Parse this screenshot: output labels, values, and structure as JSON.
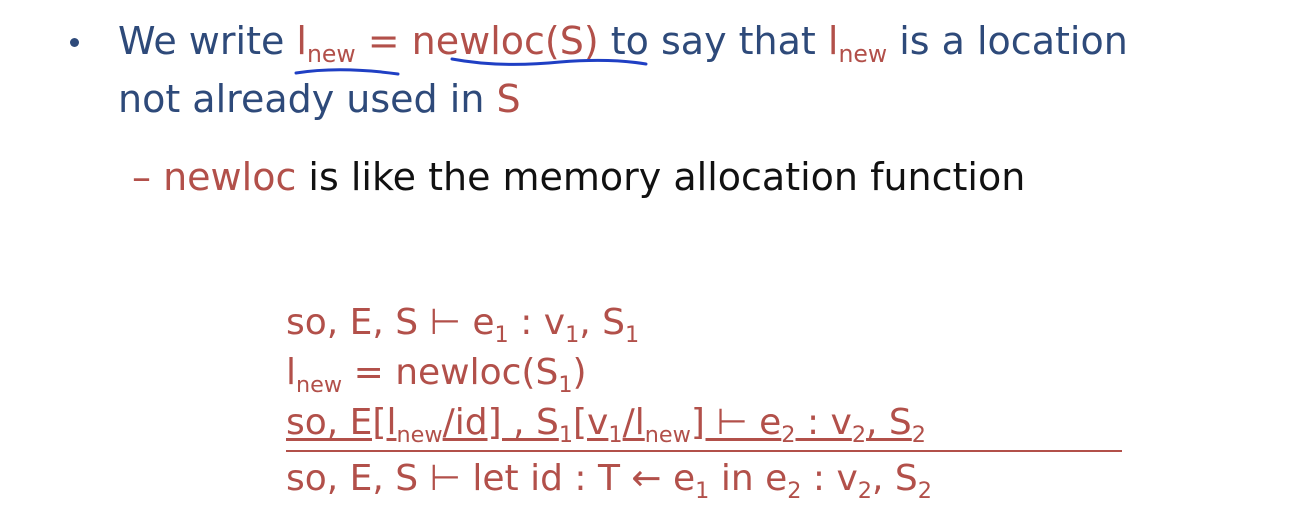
{
  "bullet": {
    "part1": "We write ",
    "lnew_l": "l",
    "lnew_sub": "new",
    "eq": " = ",
    "newloc_s": "newloc(S)",
    "part2": " to say that ",
    "lnew2_l": "l",
    "lnew2_sub": "new",
    "part3": " is a location",
    "line2a": "not already used in ",
    "line2S": "S"
  },
  "sub_bullet": {
    "dash": "– ",
    "newloc": "newloc",
    "rest": " is like the memory allocation function"
  },
  "rule": {
    "p1": "so, E, S ⊢ e",
    "p1_sub1": "1",
    "p1_b": " : v",
    "p1_sub2": "1",
    "p1_c": ", S",
    "p1_sub3": "1",
    "p2_l": "l",
    "p2_sub": "new",
    "p2_b": " = newloc(S",
    "p2_sub2": "1",
    "p2_c": ")",
    "p3_a": "so, E[l",
    "p3_sub1": "new",
    "p3_b": "/id] , S",
    "p3_sub2": "1",
    "p3_c": "[v",
    "p3_sub3": "1",
    "p3_d": "/l",
    "p3_sub4": "new",
    "p3_e": "] ⊢ e",
    "p3_sub5": "2",
    "p3_f": " : v",
    "p3_sub6": "2",
    "p3_g": ", S",
    "p3_sub7": "2",
    "c_a": "so, E, S ⊢ let id : T ← e",
    "c_sub1": "1",
    "c_b": " in e",
    "c_sub2": "2",
    "c_c": " : v",
    "c_sub3": "2",
    "c_d": ", S",
    "c_sub4": "2"
  },
  "colors": {
    "blue": "#2e4a7a",
    "red": "#b2504a",
    "ink": "#1f3fc4"
  }
}
